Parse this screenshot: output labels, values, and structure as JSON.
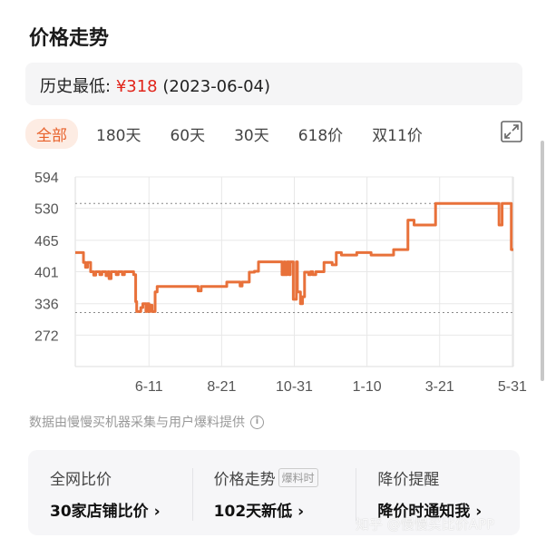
{
  "title": "价格走势",
  "history_low": {
    "label": "历史最低:",
    "price": "¥318",
    "date": "(2023-06-04)"
  },
  "tabs": [
    {
      "label": "全部",
      "active": true
    },
    {
      "label": "180天"
    },
    {
      "label": "60天"
    },
    {
      "label": "30天"
    },
    {
      "label": "618价"
    },
    {
      "label": "双11价"
    }
  ],
  "expand_icon": "expand-icon",
  "note": "数据由慢慢买机器采集与用户爆料提供",
  "cards": [
    {
      "heading": "全网比价",
      "value": "30家店铺比价 ›"
    },
    {
      "heading": "价格走势",
      "badge": "爆料时",
      "value": "102天新低 ›"
    },
    {
      "heading": "降价提醒",
      "value": "降价时通知我 ›"
    }
  ],
  "watermark": "知乎 @慢慢买比价APP",
  "colors": {
    "line": "#e8713a",
    "accent": "#e8622c",
    "price": "#e1251b"
  },
  "chart_data": {
    "type": "line",
    "step": true,
    "y_ticks": [
      594,
      530,
      465,
      401,
      336,
      272
    ],
    "ylim": [
      208,
      594
    ],
    "x_ticks": [
      "6-11",
      "8-21",
      "10-31",
      "1-10",
      "3-21",
      "5-31"
    ],
    "x_tick_dates": [
      "2023-06-11",
      "2023-08-21",
      "2023-10-31",
      "2024-01-10",
      "2024-03-21",
      "2024-05-31"
    ],
    "xlim": [
      "2023-03-31",
      "2024-06-01"
    ],
    "grid": true,
    "reference_lines": [
      {
        "value": 540,
        "style": "dashed"
      },
      {
        "value": 318,
        "style": "dashed"
      }
    ],
    "points": [
      [
        "2023-03-31",
        440
      ],
      [
        "2023-04-08",
        420
      ],
      [
        "2023-04-10",
        410
      ],
      [
        "2023-04-12",
        420
      ],
      [
        "2023-04-15",
        401
      ],
      [
        "2023-04-18",
        394
      ],
      [
        "2023-04-20",
        401
      ],
      [
        "2023-04-24",
        395
      ],
      [
        "2023-04-26",
        401
      ],
      [
        "2023-04-30",
        393
      ],
      [
        "2023-05-02",
        401
      ],
      [
        "2023-05-03",
        387
      ],
      [
        "2023-05-05",
        401
      ],
      [
        "2023-05-10",
        395
      ],
      [
        "2023-05-12",
        401
      ],
      [
        "2023-05-16",
        395
      ],
      [
        "2023-05-18",
        401
      ],
      [
        "2023-05-27",
        395
      ],
      [
        "2023-05-29",
        340
      ],
      [
        "2023-05-30",
        320
      ],
      [
        "2023-06-03",
        328
      ],
      [
        "2023-06-05",
        336
      ],
      [
        "2023-06-08",
        320
      ],
      [
        "2023-06-09",
        336
      ],
      [
        "2023-06-11",
        320
      ],
      [
        "2023-06-12",
        333
      ],
      [
        "2023-06-14",
        320
      ],
      [
        "2023-06-17",
        360
      ],
      [
        "2023-06-19",
        371
      ],
      [
        "2023-07-29",
        362
      ],
      [
        "2023-08-01",
        371
      ],
      [
        "2023-08-26",
        380
      ],
      [
        "2023-09-08",
        372
      ],
      [
        "2023-09-10",
        380
      ],
      [
        "2023-09-17",
        400
      ],
      [
        "2023-09-22",
        402
      ],
      [
        "2023-09-26",
        421
      ],
      [
        "2023-10-19",
        395
      ],
      [
        "2023-10-21",
        421
      ],
      [
        "2023-10-22",
        395
      ],
      [
        "2023-10-24",
        421
      ],
      [
        "2023-10-26",
        395
      ],
      [
        "2023-10-27",
        421
      ],
      [
        "2023-10-30",
        345
      ],
      [
        "2023-11-02",
        421
      ],
      [
        "2023-11-03",
        360
      ],
      [
        "2023-11-06",
        336
      ],
      [
        "2023-11-08",
        350
      ],
      [
        "2023-11-10",
        400
      ],
      [
        "2023-11-14",
        395
      ],
      [
        "2023-11-16",
        401
      ],
      [
        "2023-11-18",
        395
      ],
      [
        "2023-11-21",
        401
      ],
      [
        "2023-11-29",
        420
      ],
      [
        "2023-12-07",
        415
      ],
      [
        "2023-12-11",
        440
      ],
      [
        "2023-12-16",
        435
      ],
      [
        "2023-12-31",
        440
      ],
      [
        "2024-01-14",
        435
      ],
      [
        "2024-02-05",
        446
      ],
      [
        "2024-02-19",
        506
      ],
      [
        "2024-02-25",
        496
      ],
      [
        "2024-03-17",
        540
      ],
      [
        "2024-05-18",
        496
      ],
      [
        "2024-05-21",
        540
      ],
      [
        "2024-05-30",
        446
      ],
      [
        "2024-06-01",
        446
      ]
    ]
  }
}
